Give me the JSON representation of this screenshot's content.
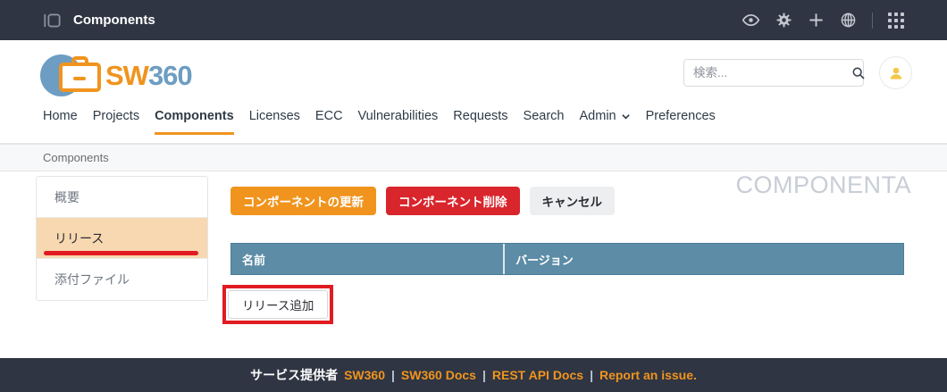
{
  "topbar": {
    "title": "Components",
    "icons": [
      "sidebar-toggle-icon",
      "eye-icon",
      "gear-icon",
      "plus-icon",
      "globe-icon",
      "apps-grid-icon"
    ]
  },
  "header": {
    "logo": {
      "sw": "SW",
      "num": "360"
    },
    "search": {
      "placeholder": "検索..."
    }
  },
  "nav": {
    "items": [
      {
        "label": "Home"
      },
      {
        "label": "Projects"
      },
      {
        "label": "Components",
        "active": true
      },
      {
        "label": "Licenses"
      },
      {
        "label": "ECC"
      },
      {
        "label": "Vulnerabilities"
      },
      {
        "label": "Requests"
      },
      {
        "label": "Search"
      },
      {
        "label": "Admin",
        "has_chevron": true
      },
      {
        "label": "Preferences"
      }
    ]
  },
  "breadcrumb": {
    "label": "Components"
  },
  "sidebar": {
    "items": [
      {
        "label": "概要",
        "active": false
      },
      {
        "label": "リリース",
        "active": true,
        "annotated": true
      },
      {
        "label": "添付ファイル",
        "active": false
      }
    ]
  },
  "main": {
    "watermark": "COMPONENTA",
    "buttons": {
      "update": "コンポーネントの更新",
      "delete": "コンポーネント削除",
      "cancel": "キャンセル"
    },
    "table": {
      "columns": [
        {
          "label": "名前"
        },
        {
          "label": "バージョン"
        }
      ],
      "rows": []
    },
    "add_release_label": "リリース追加"
  },
  "footer": {
    "provider": "サービス提供者",
    "separator": "|",
    "links": [
      {
        "label": "SW360"
      },
      {
        "label": "SW360 Docs"
      },
      {
        "label": "REST API Docs"
      },
      {
        "label": "Report an issue."
      }
    ]
  },
  "colors": {
    "topbar_dark": "#2f3542",
    "accent_orange": "#f0941e",
    "danger_red": "#d9252c",
    "table_header_blue": "#5c8ca6",
    "sidebar_active_bg": "#f7d8b0",
    "annotation_red": "#e11b22",
    "logo_blue": "#6d9dc2"
  }
}
